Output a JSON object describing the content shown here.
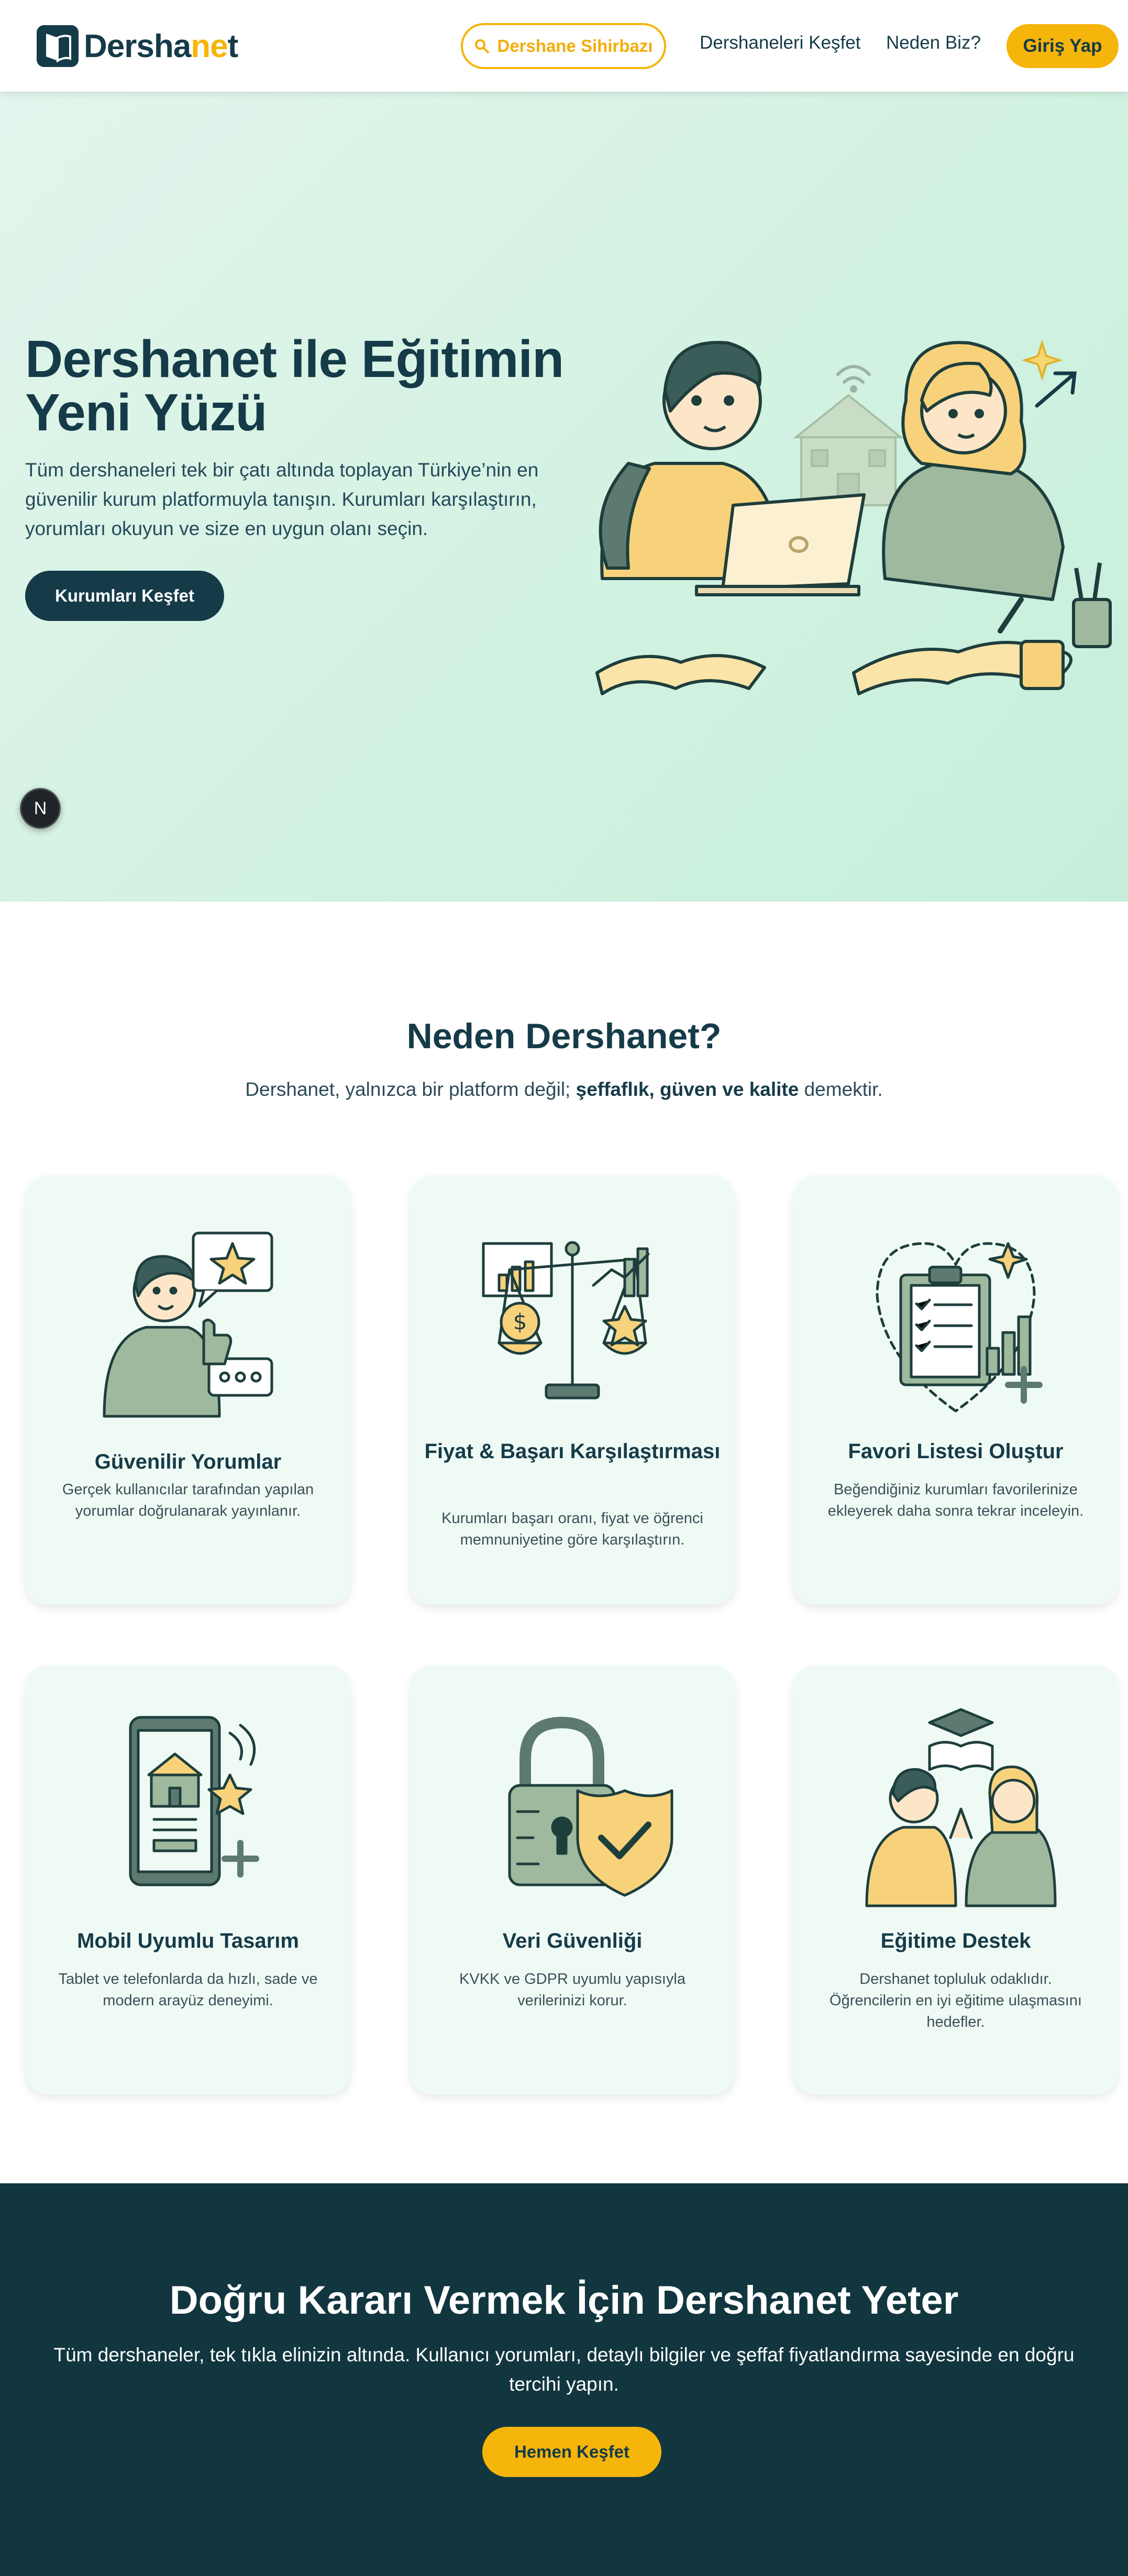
{
  "header": {
    "logo_main": "Dersha",
    "logo_accent": "ne",
    "logo_end": "t",
    "wizard_label": "Dershane Sihirbazı",
    "nav_explore": "Dershaneleri Keşfet",
    "nav_why": "Neden Biz?",
    "login_label": "Giriş Yap"
  },
  "hero": {
    "title_line1": "Dershanet ile Eğitimin",
    "title_line2": "Yeni Yüzü",
    "subtitle": "Tüm dershaneleri tek bir çatı altında toplayan Türkiye’nin en güvenilir kurum platformuyla tanışın. Kurumları karşılaştırın, yorumları okuyun ve size en uygun olanı seçin.",
    "cta_label": "Kurumları Keşfet",
    "badge_letter": "N"
  },
  "why": {
    "title": "Neden Dershanet?",
    "subtitle_pre": "Dershanet, yalnızca bir platform değil; ",
    "subtitle_bold": "şeffaflık, güven ve kalite",
    "subtitle_post": " demektir.",
    "cards": [
      {
        "title": "Güvenilir Yorumlar",
        "desc": "Gerçek kullanıcılar tarafından yapılan yorumlar doğrulanarak yayınlanır.",
        "icon": "reviews-icon"
      },
      {
        "title": "Fiyat & Başarı Karşılaştırması",
        "desc": "Kurumları başarı oranı, fiyat ve öğrenci memnuniyetine göre karşılaştırın.",
        "icon": "scale-icon"
      },
      {
        "title": "Favori Listesi Oluştur",
        "desc": "Beğendiğiniz kurumları favorilerinize ekleyerek daha sonra tekrar inceleyin.",
        "icon": "favorites-icon"
      },
      {
        "title": "Mobil Uyumlu Tasarım",
        "desc": "Tablet ve telefonlarda da hızlı, sade ve modern arayüz deneyimi.",
        "icon": "mobile-icon"
      },
      {
        "title": "Veri Güvenliği",
        "desc": "KVKK ve GDPR uyumlu yapısıyla verilerinizi korur.",
        "icon": "security-icon"
      },
      {
        "title": "Eğitime Destek",
        "desc": "Dershanet topluluk odaklıdır. Öğrencilerin en iyi eğitime ulaşmasını hedefler.",
        "icon": "education-support-icon"
      }
    ]
  },
  "cta": {
    "title": "Doğru Kararı Vermek İçin Dershanet Yeter",
    "subtitle": "Tüm dershaneler, tek tıkla elinizin altında. Kullanıcı yorumları, detaylı bilgiler ve şeffaf fiyatlandırma sayesinde en doğru tercihi yapın.",
    "button_label": "Hemen Keşfet"
  },
  "colors": {
    "brand_dark": "#153b48",
    "accent_yellow": "#f5b50a",
    "hero_bg": "#d2f2e2",
    "card_bg": "#effaf5",
    "cta_bg": "#11363f"
  }
}
